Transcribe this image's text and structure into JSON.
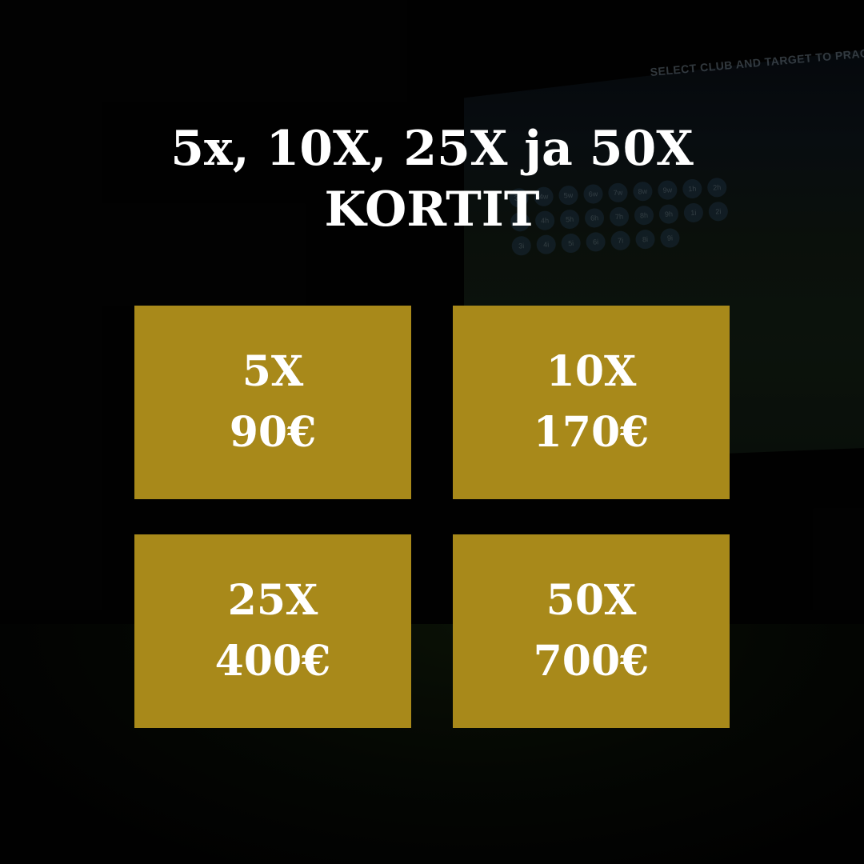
{
  "title": {
    "line1": "5x, 10X, 25X ja 50X",
    "line2": "KORTIT"
  },
  "background": {
    "screen_caption": "SELECT CLUB AND TARGET TO PRACTICE",
    "clubs": [
      "3w",
      "4w",
      "5w",
      "6w",
      "7w",
      "8w",
      "9w",
      "1h",
      "2h",
      "3h",
      "4h",
      "5h",
      "6h",
      "7h",
      "8h",
      "9h",
      "1i",
      "2i",
      "3i",
      "4i",
      "5i",
      "6i",
      "7i",
      "8i",
      "9i"
    ]
  },
  "cards": [
    {
      "count": "5X",
      "price": "90€"
    },
    {
      "count": "10X",
      "price": "170€"
    },
    {
      "count": "25X",
      "price": "400€"
    },
    {
      "count": "50X",
      "price": "700€"
    }
  ],
  "colors": {
    "card_gold": "#a8891a",
    "background": "#030303",
    "text": "#ffffff"
  }
}
